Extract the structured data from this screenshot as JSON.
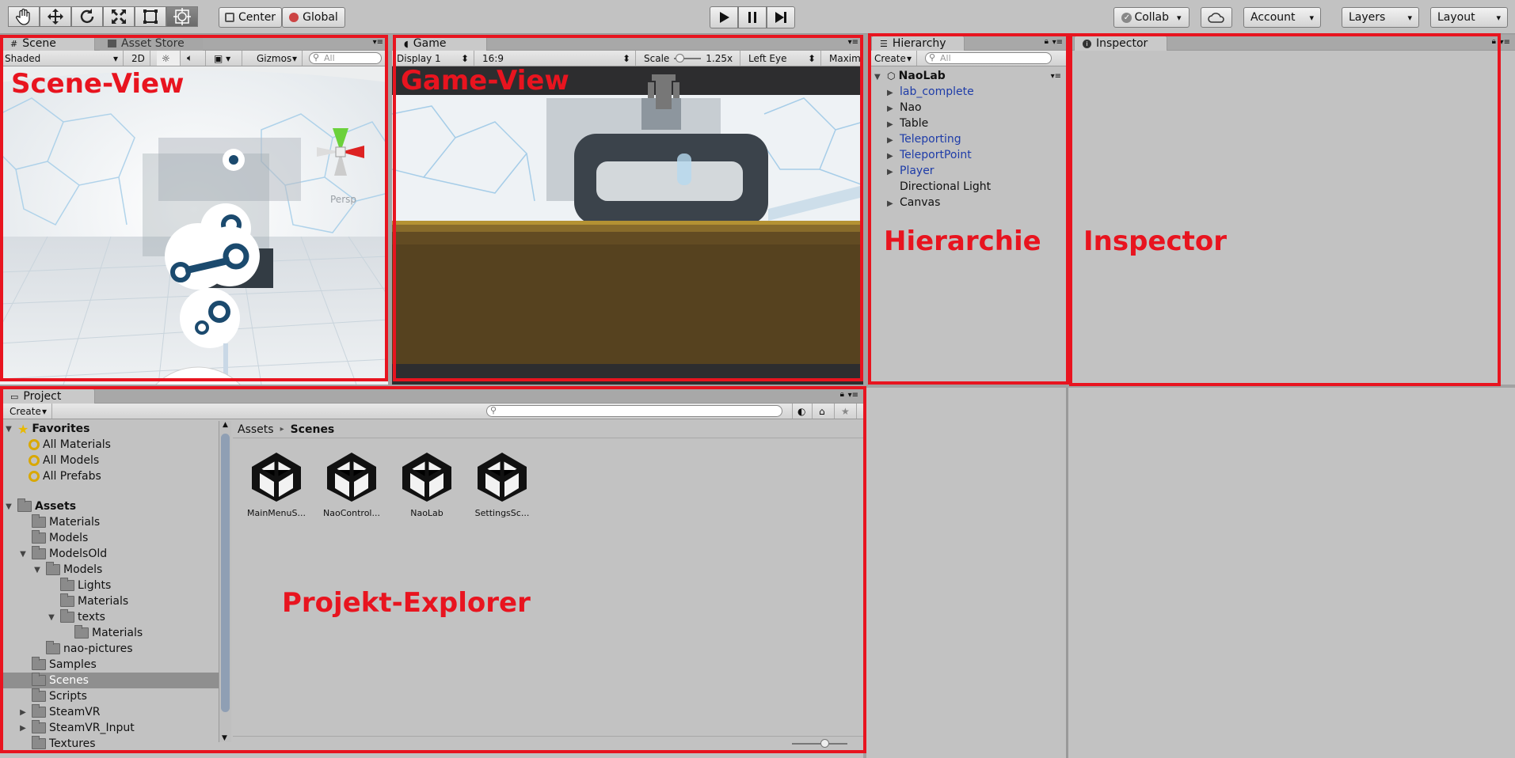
{
  "toolbar": {
    "center": "Center",
    "global": "Global",
    "collab": "Collab",
    "account": "Account",
    "layers": "Layers",
    "layout": "Layout"
  },
  "scene": {
    "tab_scene": "Scene",
    "tab_store": "Asset Store",
    "shaded": "Shaded",
    "two_d": "2D",
    "gizmos": "Gizmos",
    "search_placeholder": "All",
    "persp": "Persp",
    "overlay_label": "Scene-View"
  },
  "game": {
    "tab": "Game",
    "display": "Display 1",
    "aspect": "16:9",
    "scale_label": "Scale",
    "scale_value": "1.25x",
    "eye": "Left Eye",
    "maximize": "Maxim",
    "overlay_label": "Game-View"
  },
  "hierarchy": {
    "tab": "Hierarchy",
    "create": "Create",
    "search_placeholder": "All",
    "root": "NaoLab",
    "items": [
      {
        "label": "lab_complete",
        "expandable": true,
        "prefab": true
      },
      {
        "label": "Nao",
        "expandable": true,
        "prefab": false
      },
      {
        "label": "Table",
        "expandable": true,
        "prefab": false
      },
      {
        "label": "Teleporting",
        "expandable": true,
        "prefab": true
      },
      {
        "label": "TeleportPoint",
        "expandable": true,
        "prefab": true
      },
      {
        "label": "Player",
        "expandable": true,
        "prefab": true
      },
      {
        "label": "Directional Light",
        "expandable": false,
        "prefab": false
      },
      {
        "label": "Canvas",
        "expandable": true,
        "prefab": false
      }
    ],
    "overlay_label": "Hierarchie"
  },
  "inspector": {
    "tab": "Inspector",
    "overlay_label": "Inspector"
  },
  "project": {
    "tab": "Project",
    "create": "Create",
    "favorites": "Favorites",
    "favorite_items": [
      "All Materials",
      "All Models",
      "All Prefabs"
    ],
    "assets_root": "Assets",
    "tree": [
      {
        "label": "Materials",
        "arrow": ""
      },
      {
        "label": "Models",
        "arrow": ""
      },
      {
        "label": "ModelsOld",
        "arrow": "▼"
      },
      {
        "label": "Models",
        "arrow": "▼"
      },
      {
        "label": "Lights",
        "arrow": ""
      },
      {
        "label": "Materials",
        "arrow": ""
      },
      {
        "label": "texts",
        "arrow": "▼"
      },
      {
        "label": "Materials",
        "arrow": ""
      },
      {
        "label": "nao-pictures",
        "arrow": ""
      },
      {
        "label": "Samples",
        "arrow": ""
      },
      {
        "label": "Scenes",
        "arrow": ""
      },
      {
        "label": "Scripts",
        "arrow": ""
      },
      {
        "label": "SteamVR",
        "arrow": "▶"
      },
      {
        "label": "SteamVR_Input",
        "arrow": "▶"
      },
      {
        "label": "Textures",
        "arrow": ""
      }
    ],
    "breadcrumb_root": "Assets",
    "breadcrumb_sep": "▸",
    "breadcrumb_current": "Scenes",
    "assets": [
      "MainMenuS...",
      "NaoControl...",
      "NaoLab",
      "SettingsSc..."
    ],
    "overlay_label": "Projekt-Explorer"
  }
}
